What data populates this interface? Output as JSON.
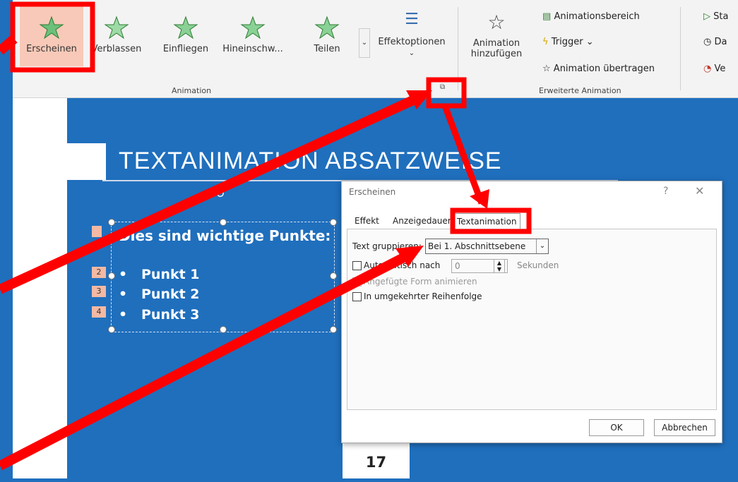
{
  "ribbon": {
    "animations": [
      {
        "label": "Erscheinen"
      },
      {
        "label": "Verblassen"
      },
      {
        "label": "Einfliegen"
      },
      {
        "label": "Hineinschw..."
      },
      {
        "label": "Teilen"
      }
    ],
    "effektoptionen": "Effektoptionen",
    "animation_group_label": "Animation",
    "animation_hinzufuegen_line1": "Animation",
    "animation_hinzufuegen_line2": "hinzufügen",
    "animationsbereich": "Animationsbereich",
    "trigger": "Trigger",
    "animation_uebertragen": "Animation übertragen",
    "erweiterte_label": "Erweiterte Animation",
    "start_partial": "Sta",
    "dauer_partial": "Da",
    "ver_partial": "Ve"
  },
  "slide": {
    "title": "Textanimation Absatzweise",
    "heading": "Dies sind wichtige Punkte:",
    "bullets": [
      "Punkt 1",
      "Punkt 2",
      "Punkt 3"
    ],
    "tags": [
      "2",
      "3",
      "4"
    ],
    "page_number": "17"
  },
  "dialog": {
    "title": "Erscheinen",
    "help": "?",
    "close": "✕",
    "tabs": [
      "Effekt",
      "Anzeigedauer",
      "Textanimation"
    ],
    "group_label": "Text gruppieren:",
    "group_value": "Bei 1. Abschnittsebene",
    "auto_label": "Automatisch nach",
    "auto_value": "0",
    "seconds": "Sekunden",
    "attached_shape": "Angefügte Form animieren",
    "reverse": "In umgekehrter Reihenfolge",
    "ok": "OK",
    "cancel": "Abbrechen"
  },
  "colors": {
    "highlight": "#ff0000",
    "slide_bg": "#1f6fbd",
    "selected_anim": "#f8c9b8"
  }
}
